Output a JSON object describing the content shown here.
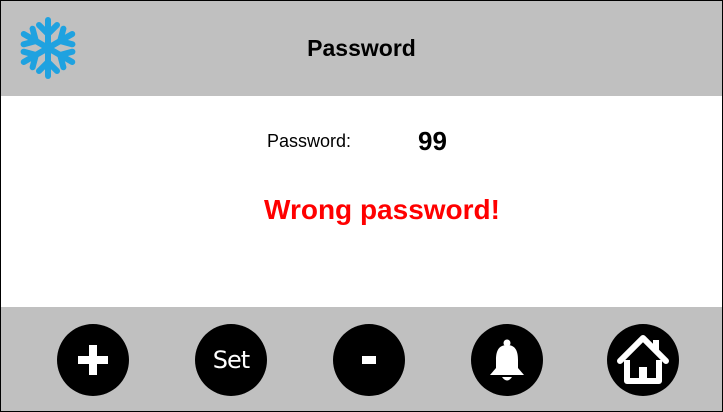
{
  "header": {
    "title": "Password",
    "icon": "snowflake-icon"
  },
  "content": {
    "password_label": "Password:",
    "password_value": "99",
    "error_message": "Wrong password!"
  },
  "footer": {
    "buttons": [
      {
        "icon": "plus-icon"
      },
      {
        "label": "Set"
      },
      {
        "icon": "minus-icon"
      },
      {
        "icon": "bell-icon"
      },
      {
        "icon": "home-icon"
      }
    ]
  },
  "colors": {
    "bar_background": "#c0c0c0",
    "snowflake": "#1fa2e0",
    "error": "#ff0000",
    "button": "#000000"
  }
}
